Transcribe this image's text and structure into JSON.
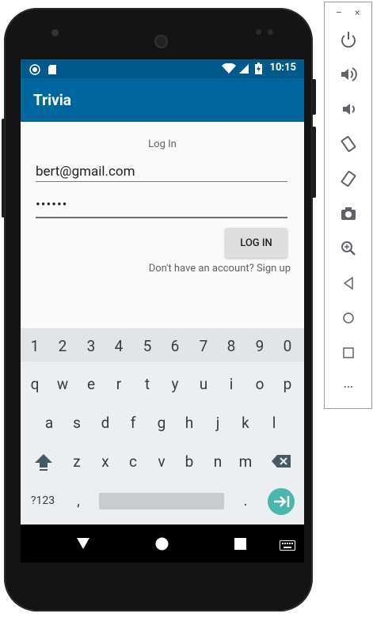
{
  "status_bar": {
    "time": "10:15"
  },
  "app_bar": {
    "title": "Trivia"
  },
  "login_form": {
    "title": "Log In",
    "email_value": "bert@gmail.com",
    "password_value": "••••••",
    "login_button": "LOG IN",
    "signup_link": "Don't have an account? Sign up"
  },
  "keyboard": {
    "number_row": [
      "1",
      "2",
      "3",
      "4",
      "5",
      "6",
      "7",
      "8",
      "9",
      "0"
    ],
    "row1": [
      "q",
      "w",
      "e",
      "r",
      "t",
      "y",
      "u",
      "i",
      "o",
      "p"
    ],
    "row2": [
      "a",
      "s",
      "d",
      "f",
      "g",
      "h",
      "j",
      "k",
      "l"
    ],
    "row3": [
      "z",
      "x",
      "c",
      "v",
      "b",
      "n",
      "m"
    ],
    "symbols_key": "?123",
    "comma_key": ",",
    "period_key": ".",
    "accent_color": "#4db6ac"
  },
  "emulator_toolbar": {
    "minimize_label": "–",
    "close_label": "×",
    "more_label": "..."
  },
  "colors": {
    "status_bar": "#005a8c",
    "app_bar": "#00679e"
  }
}
